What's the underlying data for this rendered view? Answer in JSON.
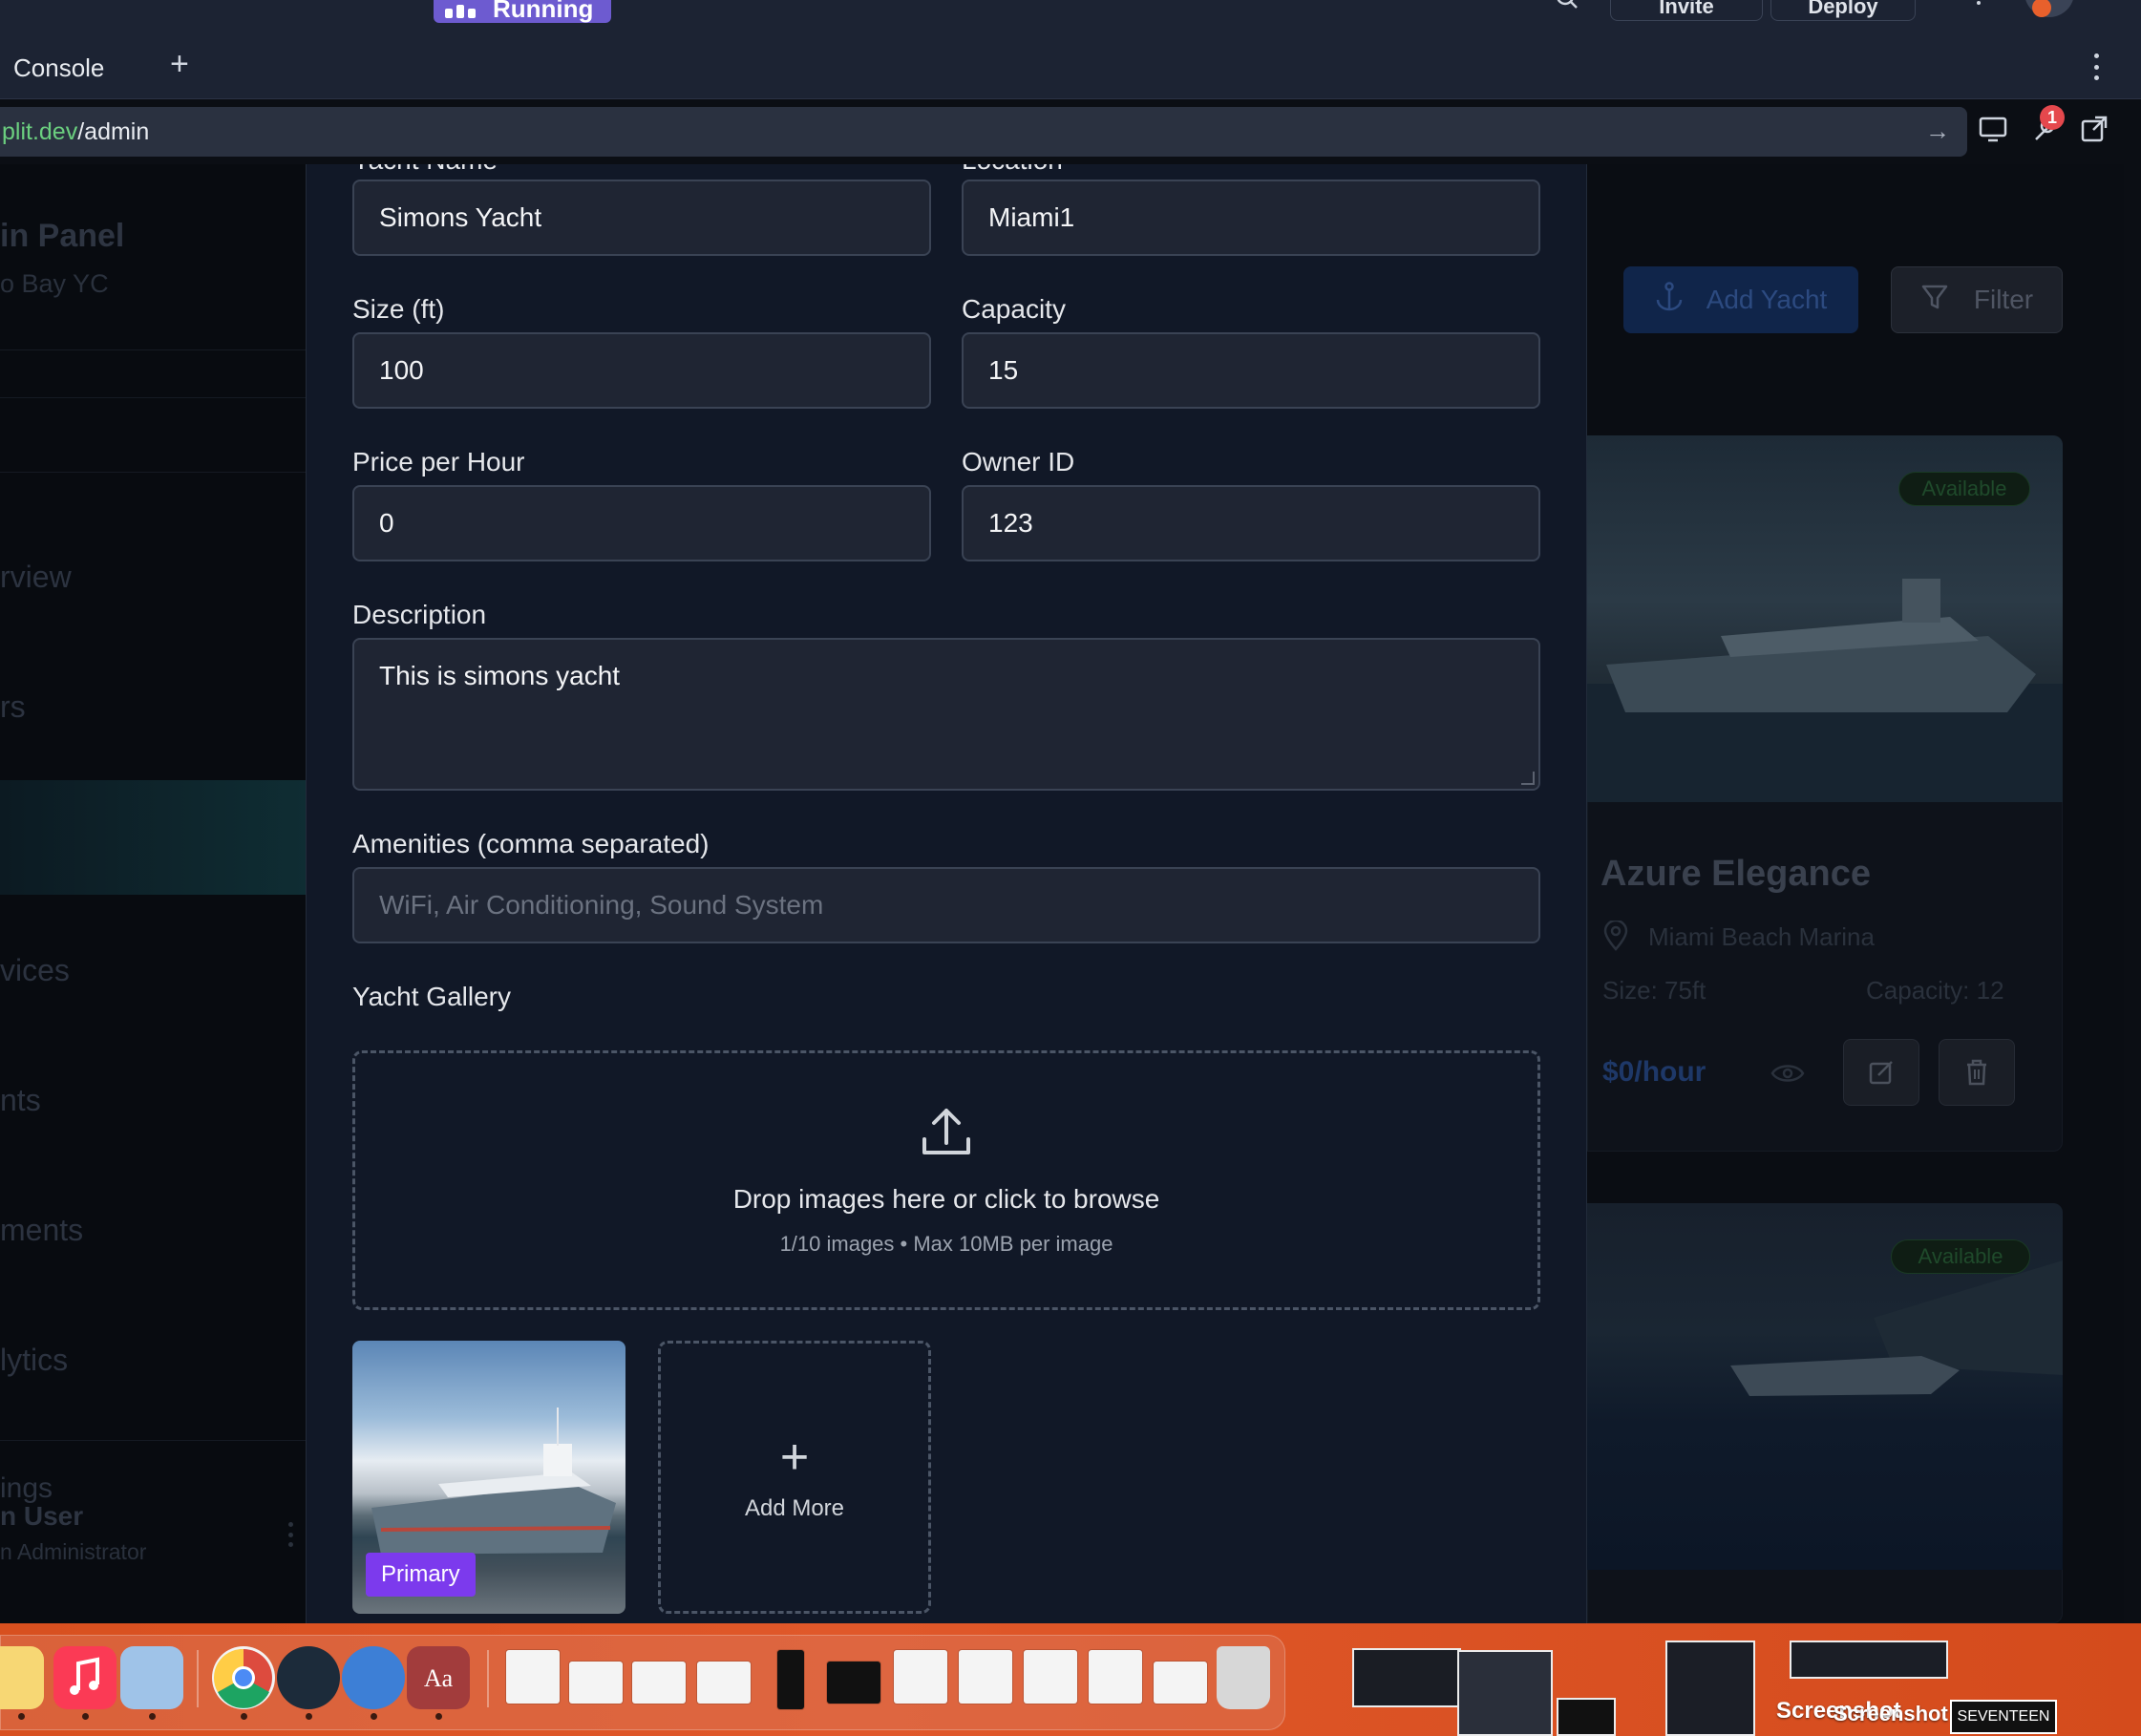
{
  "topbar": {
    "run_label": "Running",
    "invite_label": "Invite",
    "deploy_label": "Deploy"
  },
  "tabs": {
    "console_label": "Console",
    "add_tab": "+"
  },
  "urlbar": {
    "host": "plit.dev",
    "path": "/admin",
    "notification_count": "1"
  },
  "sidebar": {
    "title": "in Panel",
    "subtitle": "o Bay YC",
    "items": [
      {
        "label": "rview"
      },
      {
        "label": "rs"
      },
      {
        "label": "vices"
      },
      {
        "label": "nts"
      },
      {
        "label": "ments"
      },
      {
        "label": "lytics"
      },
      {
        "label": "ings"
      }
    ],
    "user_name": "n User",
    "user_role": "n Administrator"
  },
  "form": {
    "yacht_name": {
      "label": "Yacht Name",
      "value": "Simons Yacht"
    },
    "location": {
      "label": "Location",
      "value": "Miami1"
    },
    "size": {
      "label": "Size (ft)",
      "value": "100"
    },
    "capacity": {
      "label": "Capacity",
      "value": "15"
    },
    "price": {
      "label": "Price per Hour",
      "value": "0"
    },
    "owner": {
      "label": "Owner ID",
      "value": "123"
    },
    "description": {
      "label": "Description",
      "value": "This is simons yacht"
    },
    "amenities": {
      "label": "Amenities (comma separated)",
      "value": "",
      "placeholder": "WiFi, Air Conditioning, Sound System"
    },
    "gallery": {
      "label": "Yacht Gallery",
      "drop_text": "Drop images here or click to browse",
      "limits": "1/10 images • Max 10MB per image",
      "primary_tag": "Primary",
      "add_more": "Add More"
    }
  },
  "yachts_page": {
    "add_button": "Add Yacht",
    "filter_button": "Filter",
    "cards": [
      {
        "status": "Available",
        "name": "Azure Elegance",
        "location": "Miami Beach Marina",
        "size": "Size: 75ft",
        "capacity": "Capacity: 12",
        "price": "$0/hour"
      },
      {
        "status": "Available"
      }
    ]
  },
  "dock": {
    "desktop_label_1": "Screenshot",
    "desktop_label_2": "Screenshot",
    "desktop_label_3": "SEVENTEEN"
  },
  "colors": {
    "modal_bg": "#111827",
    "field_bg": "#1f2533",
    "accent_primary": "#7c3aed",
    "url_host": "#6bcf7f"
  }
}
